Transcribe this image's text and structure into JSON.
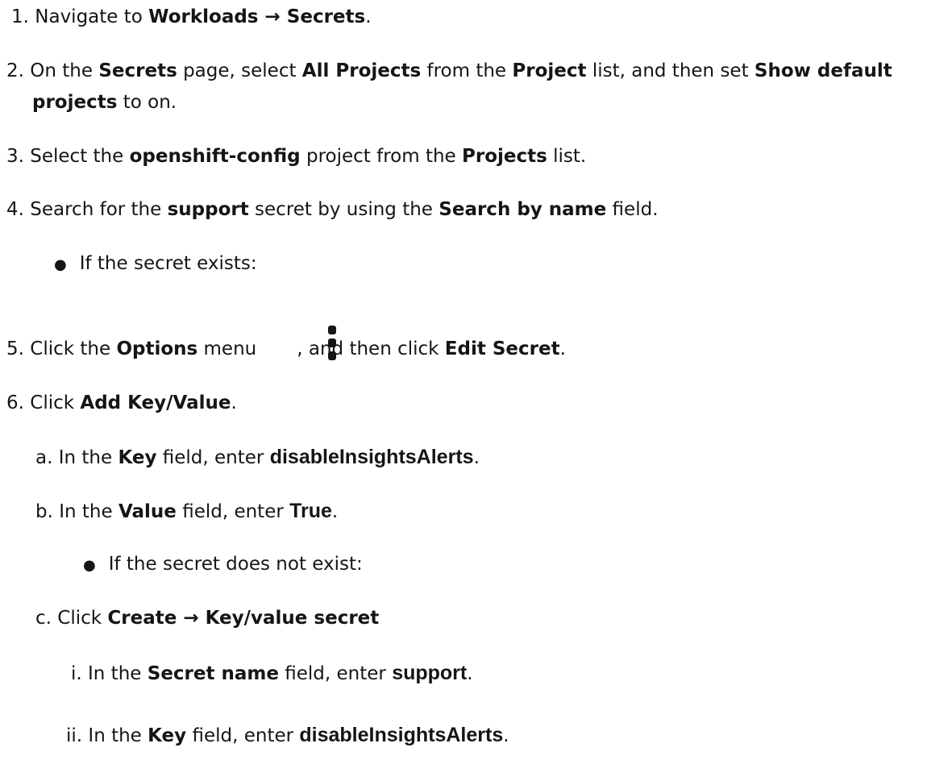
{
  "steps": {
    "s1": {
      "num": "1.",
      "t1": "Navigate to ",
      "b1": "Workloads → Secrets",
      "t2": "."
    },
    "s2": {
      "num": "2.",
      "t1": "On the ",
      "b1": "Secrets",
      "t2": " page, select ",
      "b2": "All Projects",
      "t3": " from the ",
      "b3": "Project",
      "t4": " list, and then set ",
      "b4": "Show default",
      "b5": "projects",
      "t5": " to on."
    },
    "s3": {
      "num": "3.",
      "t1": "Select the ",
      "b1": "openshift-config",
      "t2": " project from the ",
      "b2": "Projects",
      "t3": " list."
    },
    "s4": {
      "num": "4.",
      "t1": "Search for the ",
      "b1": "support",
      "t2": " secret by using the ",
      "b2": "Search by name",
      "t3": " field."
    },
    "bullet1": {
      "mark": "●",
      "text": "If the secret exists:"
    },
    "s5": {
      "num": "5.",
      "t1": "Click the ",
      "b1": "Options",
      "t2": " menu",
      "t3": ", and then click ",
      "b2": "Edit Secret",
      "t4": "."
    },
    "s6": {
      "num": "6.",
      "t1": "Click ",
      "b1": "Add Key/Value",
      "t2": "."
    },
    "sa": {
      "num": "a.",
      "t1": "In the ",
      "b1": "Key",
      "t2": " field, enter ",
      "b2": "disableInsightsAlerts",
      "t3": "."
    },
    "sb": {
      "num": "b.",
      "t1": "In the ",
      "b1": "Value",
      "t2": " field, enter ",
      "b2": "True",
      "t3": "."
    },
    "bullet2": {
      "mark": "●",
      "text": "If the secret does not exist:"
    },
    "sc": {
      "num": "c.",
      "t1": "Click ",
      "b1": "Create → Key/value secret"
    },
    "si": {
      "num": "i.",
      "t1": "In the ",
      "b1": "Secret name",
      "t2": " field, enter ",
      "b2": "support",
      "t3": "."
    },
    "sii": {
      "num": "ii.",
      "t1": "In the ",
      "b1": "Key",
      "t2": " field, enter ",
      "b2": "disableInsightsAlerts",
      "t3": "."
    }
  },
  "icons": {
    "options": "kebab-icon"
  }
}
